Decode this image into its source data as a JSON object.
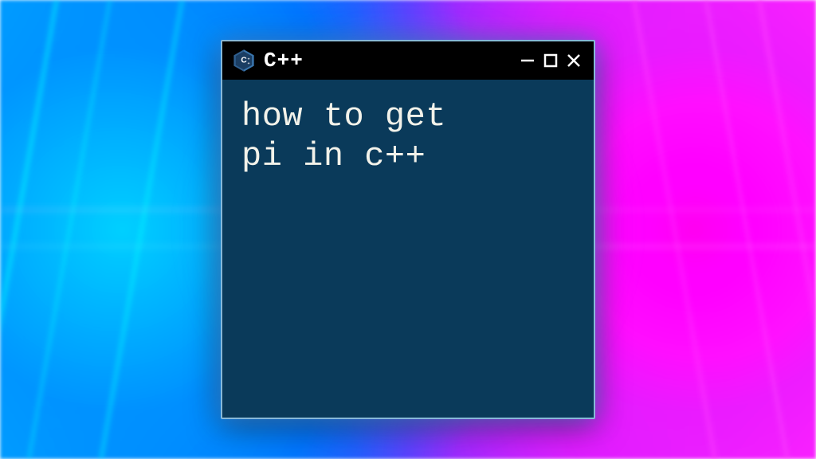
{
  "window": {
    "title": "C++",
    "logo_name": "cpp-logo-icon",
    "controls": {
      "minimize": "minimize-icon",
      "maximize": "maximize-icon",
      "close": "close-icon"
    }
  },
  "content": {
    "text": "how to get\npi in c++"
  },
  "colors": {
    "window_bg": "#0a3a5a",
    "titlebar_bg": "#000000",
    "text": "#f2f2ea",
    "border": "#87b8d8"
  }
}
